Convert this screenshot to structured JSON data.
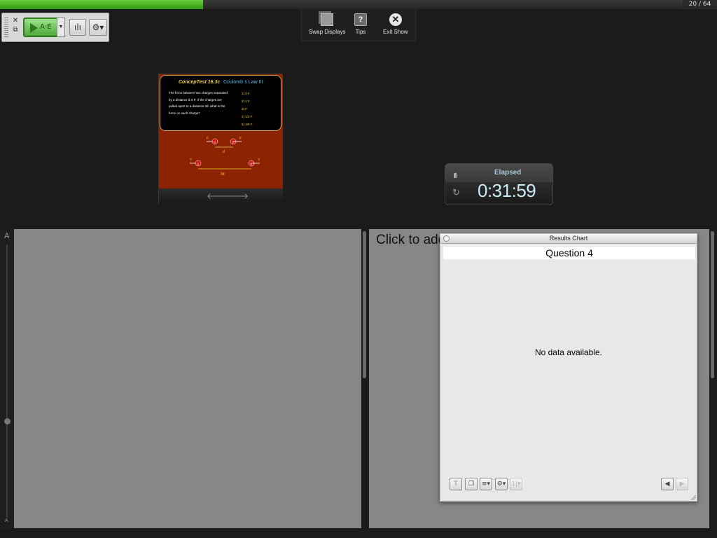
{
  "progress": {
    "fraction": 0.297,
    "counter": "20 / 64"
  },
  "toolbar": {
    "poll_label": "A-E",
    "mini_close": "✕",
    "mini_copy": "⧉",
    "chart_glyph": "ılı",
    "settings_glyph": "⚙▾",
    "dropdown_glyph": "▼"
  },
  "show_menu": {
    "swap": "Swap Displays",
    "tips": "Tips",
    "tips_glyph": "?",
    "exit": "Exit Show",
    "exit_glyph": "✕"
  },
  "slide": {
    "title_a": "ConcepTest 16.3c",
    "title_b": "Coulomb`s Law III",
    "question": "The force between two charges separated by a distance d is F. If the charges are pulled apart to a distance 3d, what is the force on each charge?",
    "options": [
      "1)  9 F",
      "2)  3 F",
      "3)  F",
      "4)  1/3 F",
      "5)  1/9 F"
    ],
    "diagram": {
      "f_label": "F",
      "q_label": "Q",
      "d_label": "d",
      "unknown_label": "?",
      "d3_label": "3d"
    },
    "prev_glyph": "🡐",
    "next_glyph": "🡒"
  },
  "timer": {
    "label": "Elapsed",
    "value": "0:31:59",
    "pause_glyph": "II",
    "reset_glyph": "↻"
  },
  "left_pane": {
    "top_letter": "A",
    "bottom_letter": "A"
  },
  "right_pane": {
    "placeholder": "Click to add"
  },
  "results": {
    "title": "Results Chart",
    "question": "Question 4",
    "message": "No data available.",
    "buttons": {
      "filter": "⊤",
      "windows": "❐",
      "sort": "≡▾",
      "chart": "⚙▾",
      "disabled": "1|▾",
      "prev": "◀",
      "next": "▶"
    }
  }
}
